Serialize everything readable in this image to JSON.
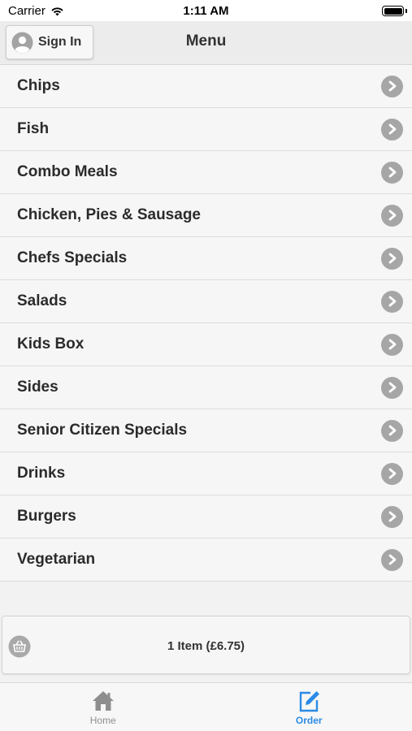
{
  "status_bar": {
    "carrier": "Carrier",
    "time": "1:11 AM",
    "wifi_icon": "wifi-icon",
    "battery_icon": "battery-icon"
  },
  "header": {
    "sign_in_label": "Sign In",
    "sign_in_icon": "user-avatar-icon",
    "title": "Menu"
  },
  "menu": {
    "items": [
      {
        "label": "Chips"
      },
      {
        "label": "Fish"
      },
      {
        "label": "Combo Meals"
      },
      {
        "label": "Chicken, Pies & Sausage"
      },
      {
        "label": "Chefs Specials"
      },
      {
        "label": "Salads"
      },
      {
        "label": "Kids Box"
      },
      {
        "label": "Sides"
      },
      {
        "label": "Senior Citizen Specials"
      },
      {
        "label": "Drinks"
      },
      {
        "label": "Burgers"
      },
      {
        "label": "Vegetarian"
      }
    ]
  },
  "basket": {
    "icon": "basket-icon",
    "summary": "1 Item (£6.75)"
  },
  "tabs": [
    {
      "label": "Home",
      "icon": "home-icon",
      "active": false
    },
    {
      "label": "Order",
      "icon": "edit-icon",
      "active": true
    }
  ],
  "colors": {
    "accent": "#2b8be6",
    "inactive_tab": "#8e8e8e",
    "chevron_bg": "#a6a6a6",
    "row_bg": "#f6f6f6",
    "header_bg": "#ececec"
  }
}
